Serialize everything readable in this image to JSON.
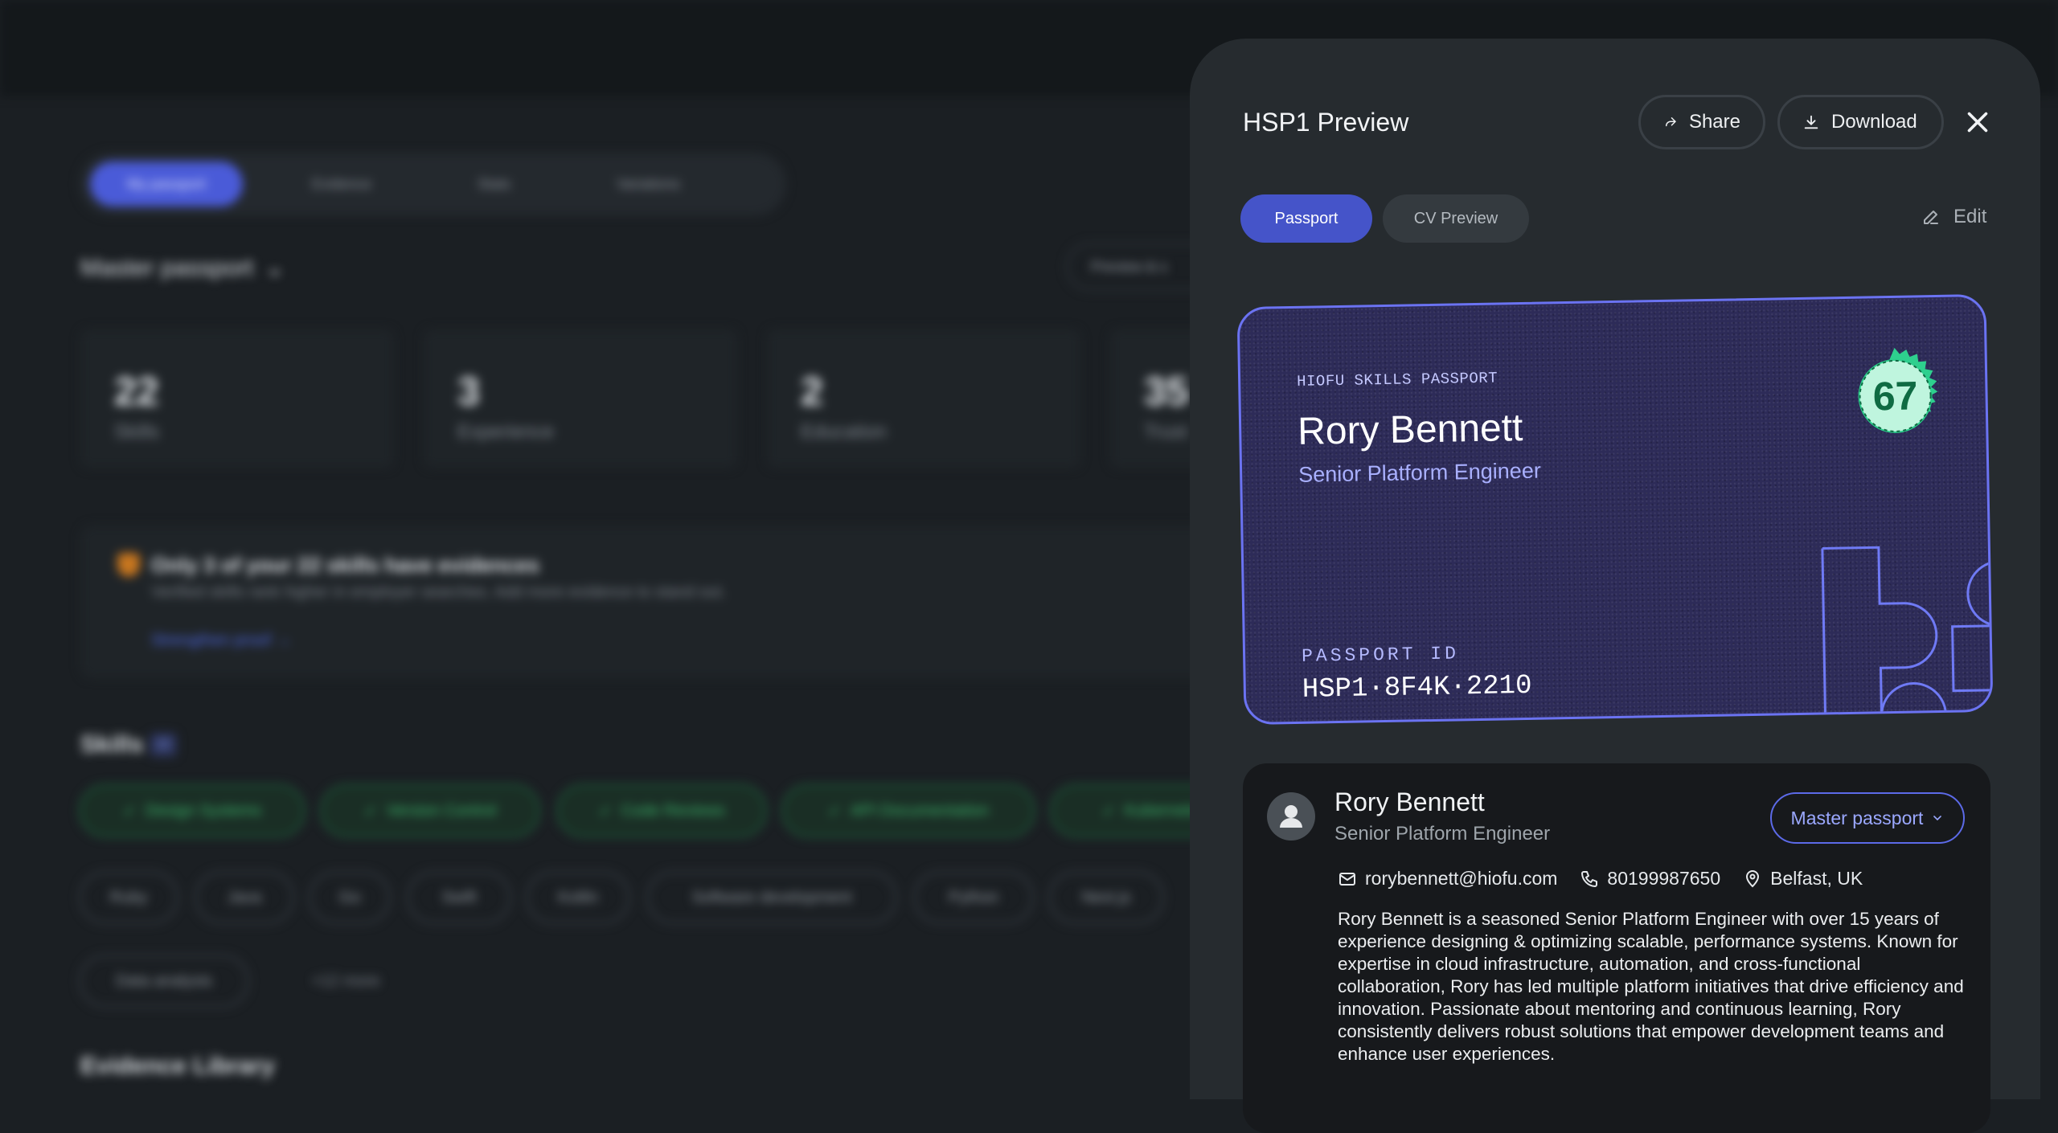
{
  "background": {
    "nav": [
      "My passport",
      "Evidence",
      "Stats",
      "Variations"
    ],
    "passport_selector": "Master passport",
    "preview_button": "Preview & s",
    "stats": [
      {
        "value": "22",
        "label": "Skills"
      },
      {
        "value": "3",
        "label": "Experience"
      },
      {
        "value": "2",
        "label": "Education"
      },
      {
        "value": "35",
        "label": "Trust"
      }
    ],
    "notice": {
      "title": "Only 3 of your 22 skills have evidences",
      "subtitle": "Verified skills rank higher in employer searches. Add more evidence to stand out.",
      "link": "Strengthen proof →"
    },
    "skills_heading": "Skills",
    "skills_count": "22",
    "verified_skills": [
      "Design Systems",
      "Version Control",
      "Code Reviews",
      "API Documentation",
      "Kubernetes"
    ],
    "skills_row2": [
      "Ruby",
      "Java",
      "Go",
      "Swift",
      "Kotlin",
      "Software development",
      "Python",
      "Next.js"
    ],
    "skills_row3": [
      "Data analysis",
      "+12 more"
    ],
    "evidence_heading": "Evidence Library"
  },
  "panel": {
    "title": "HSP1 Preview",
    "share_label": "Share",
    "download_label": "Download",
    "tabs": {
      "passport": "Passport",
      "cv": "CV Preview"
    },
    "edit_label": "Edit",
    "card": {
      "kicker": "HIOFU SKILLS PASSPORT",
      "name": "Rory Bennett",
      "role": "Senior Platform Engineer",
      "score": "67",
      "passport_id_label": "PASSPORT ID",
      "passport_id": "HSP1·8F4K·2210"
    },
    "profile": {
      "name": "Rory Bennett",
      "role": "Senior Platform Engineer",
      "variant": "Master passport",
      "email": "rorybennett@hiofu.com",
      "phone": "80199987650",
      "location": "Belfast, UK",
      "bio": "Rory Bennett is a seasoned Senior Platform Engineer with over 15 years of experience designing & optimizing scalable, performance systems. Known for expertise in cloud infrastructure, automation, and cross-functional collaboration, Rory has led multiple platform initiatives that drive efficiency and innovation. Passionate about mentoring and continuous learning, Rory consistently delivers robust solutions that empower development teams and enhance user experiences."
    }
  },
  "colors": {
    "accent": "#4554c9",
    "card_bg": "#2d2b58",
    "badge": "#2ecf8e",
    "verified": "#3bb46a"
  }
}
